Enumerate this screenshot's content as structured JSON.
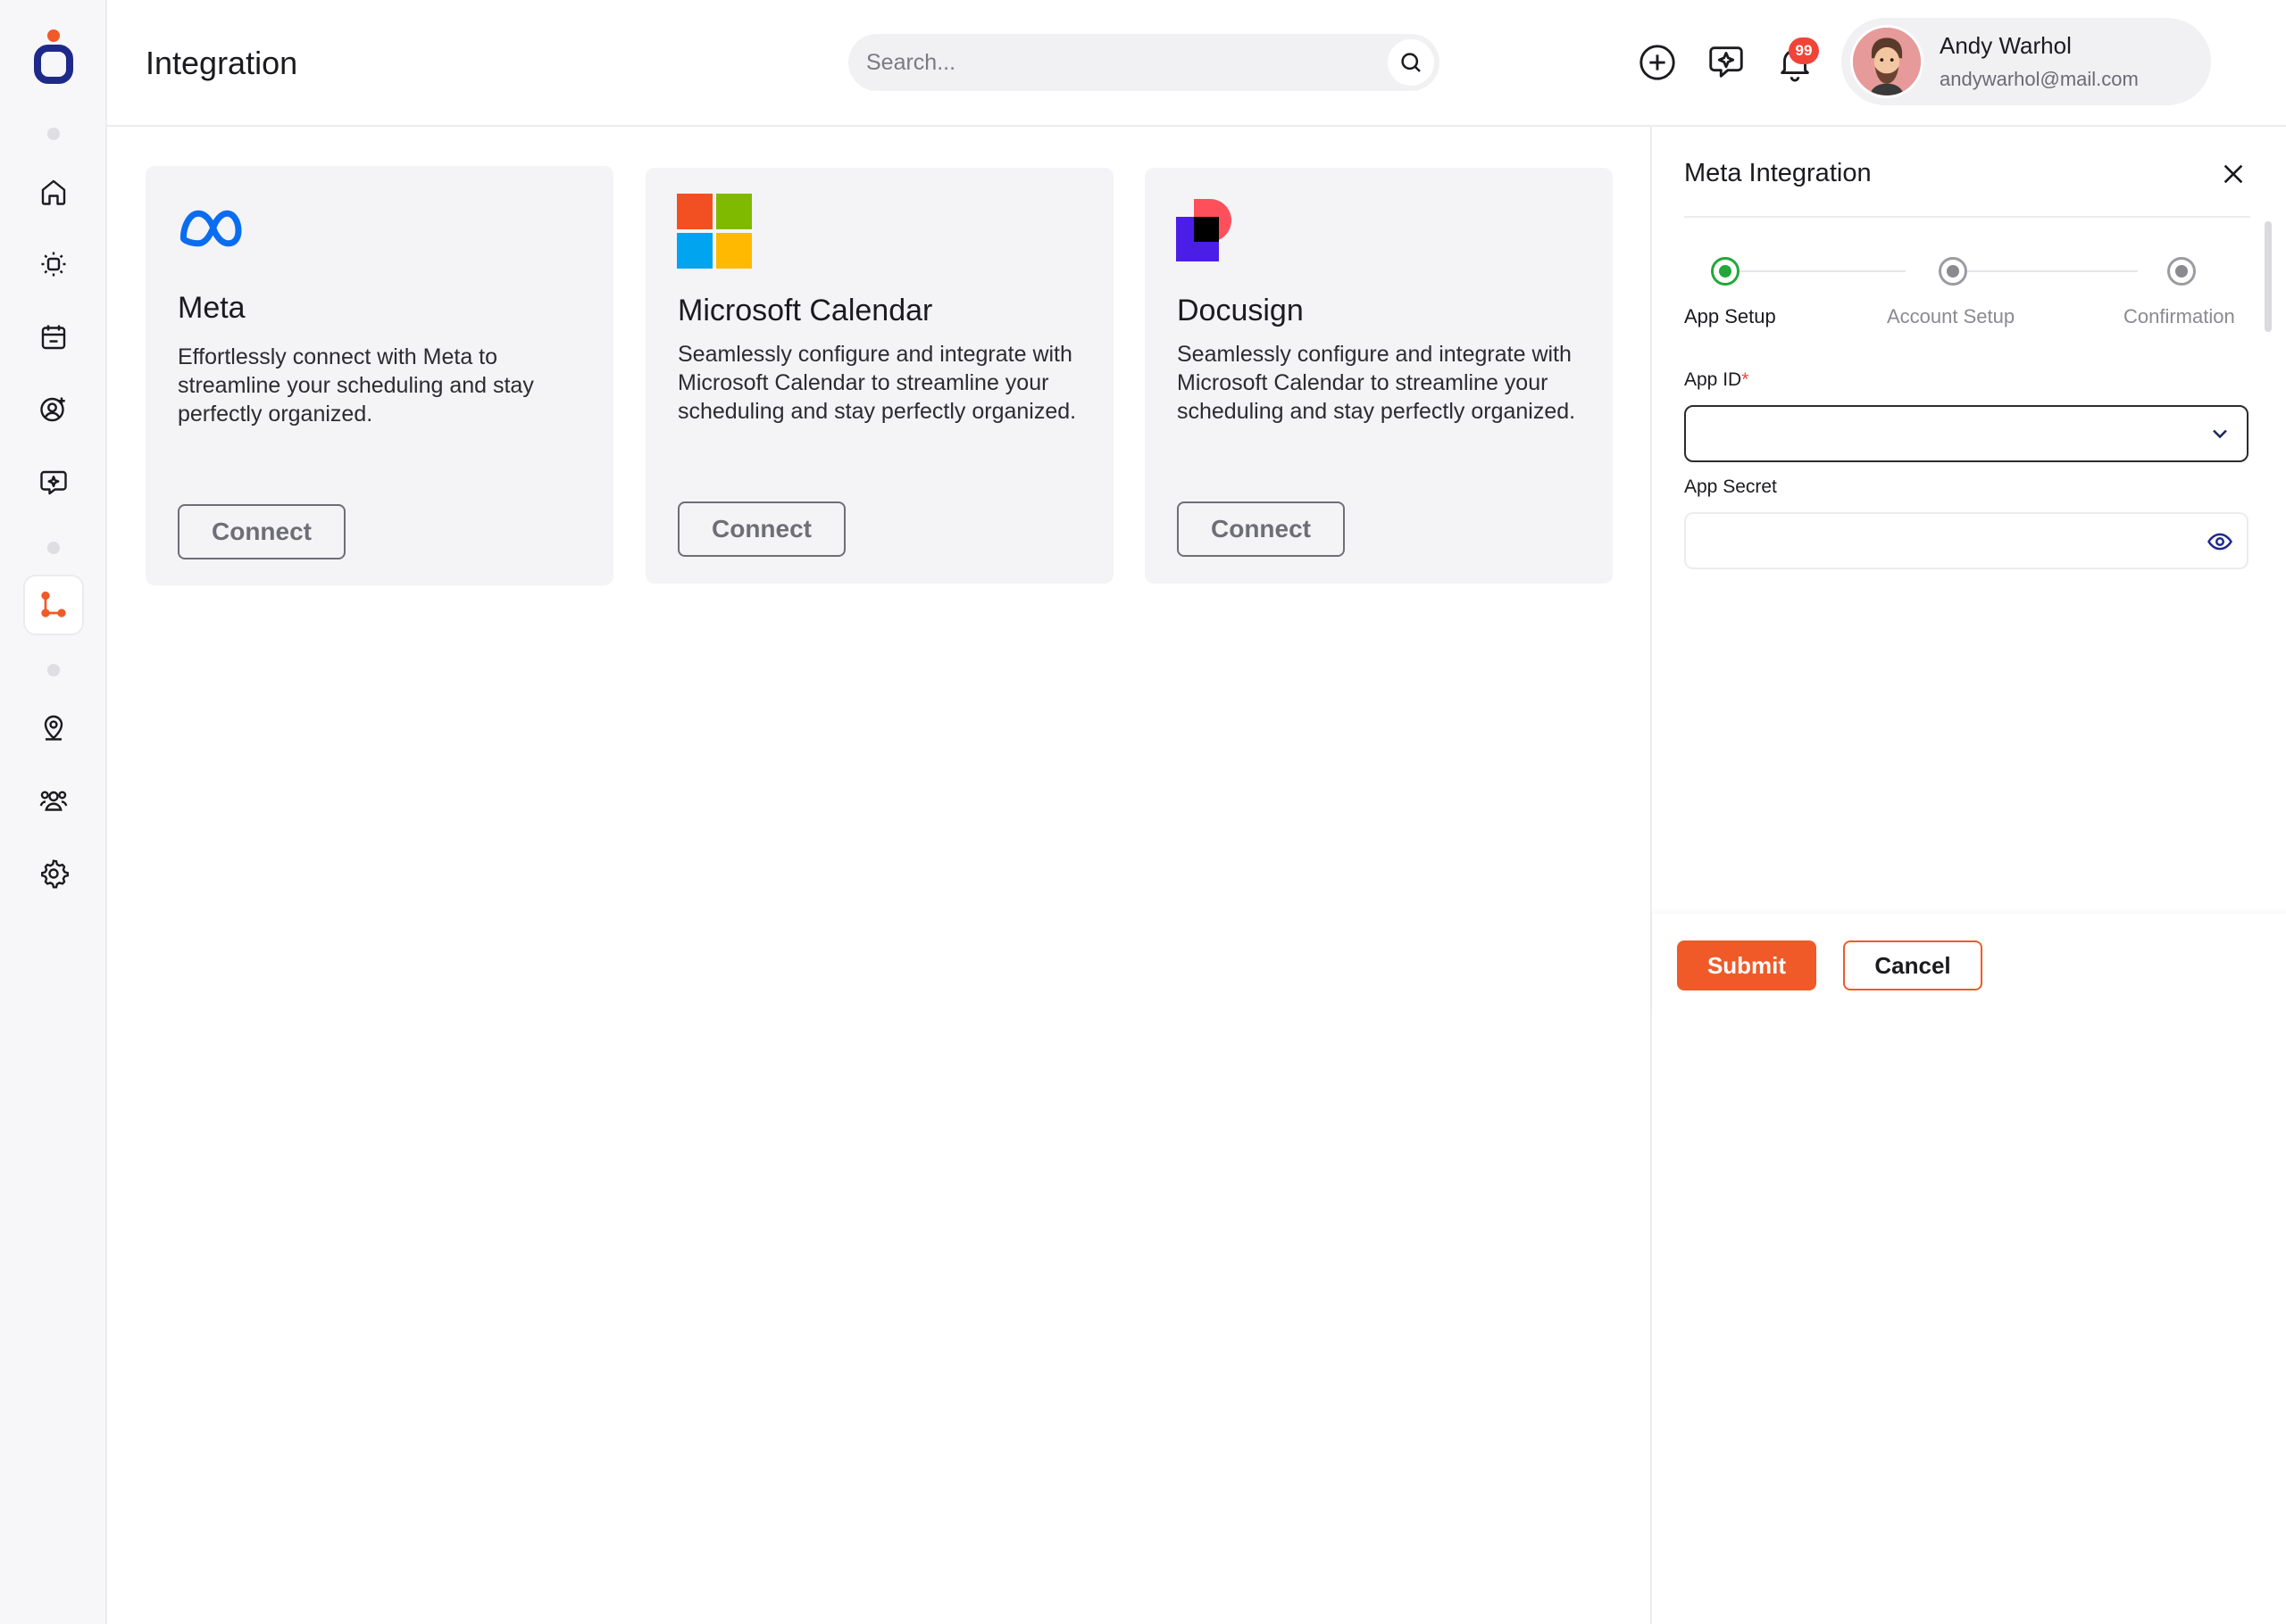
{
  "header": {
    "title": "Integration",
    "search_placeholder": "Search...",
    "notification_count": "99",
    "user": {
      "name": "Andy Warhol",
      "email": "andywarhol@mail.com"
    }
  },
  "sidebar": {
    "items": [
      {
        "icon": "home-icon"
      },
      {
        "icon": "dashboard-icon"
      },
      {
        "icon": "calendar-icon"
      },
      {
        "icon": "add-user-icon"
      },
      {
        "icon": "ai-chat-icon"
      },
      {
        "icon": "integration-icon",
        "active": true
      },
      {
        "icon": "location-icon"
      },
      {
        "icon": "team-icon"
      },
      {
        "icon": "settings-icon"
      }
    ]
  },
  "cards": [
    {
      "title": "Meta",
      "description": "Effortlessly connect with Meta to streamline your scheduling and stay perfectly organized.",
      "button": "Connect"
    },
    {
      "title": "Microsoft Calendar",
      "description": "Seamlessly configure and integrate with Microsoft Calendar to streamline your scheduling and stay perfectly organized.",
      "button": "Connect"
    },
    {
      "title": "Docusign",
      "description": "Seamlessly configure and integrate with Microsoft Calendar to streamline your scheduling and stay perfectly organized.",
      "button": "Connect"
    }
  ],
  "panel": {
    "title": "Meta Integration",
    "steps": [
      {
        "label": "App Setup",
        "active": true
      },
      {
        "label": "Account Setup",
        "active": false
      },
      {
        "label": "Confirmation",
        "active": false
      }
    ],
    "app_id_label": "App ID",
    "required_mark": "*",
    "app_id_value": "",
    "app_secret_label": "App Secret",
    "app_secret_value": "",
    "submit": "Submit",
    "cancel": "Cancel"
  },
  "colors": {
    "accent": "#f05a28",
    "step_active": "#22a83a",
    "badge": "#f04438"
  }
}
